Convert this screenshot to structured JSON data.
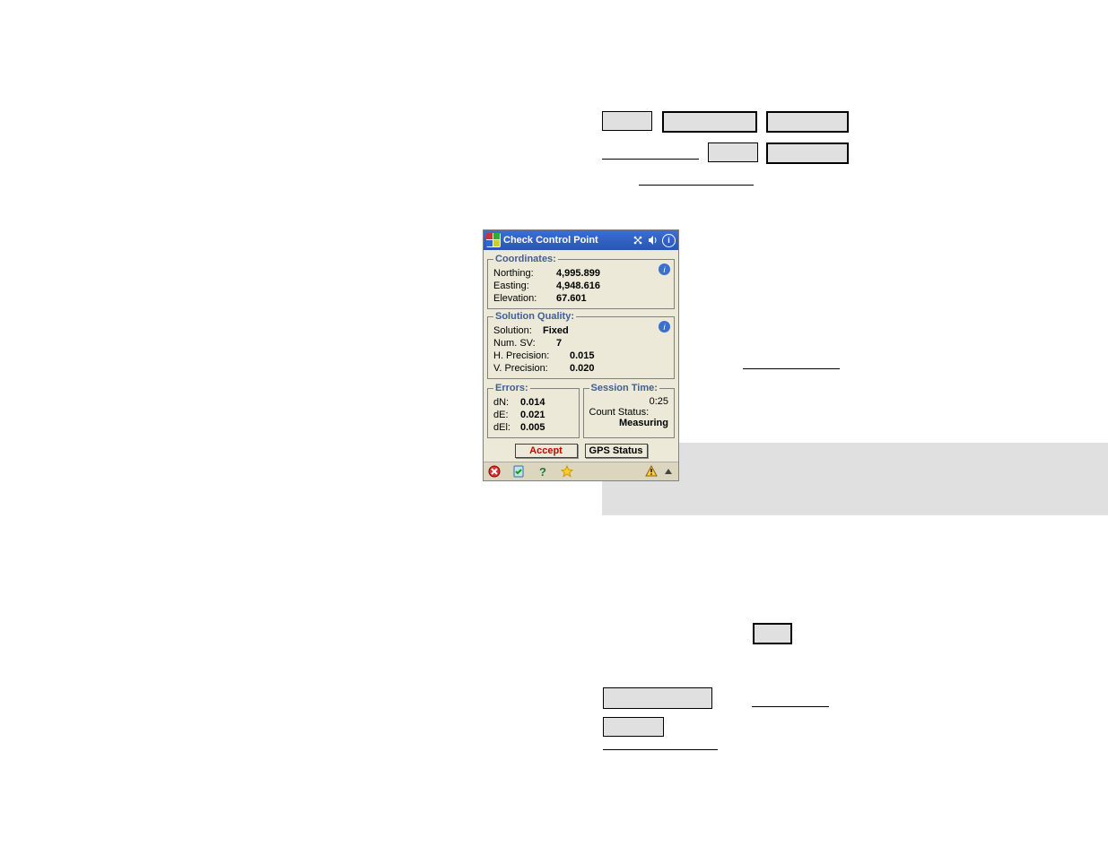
{
  "titlebar": {
    "title": "Check Control Point"
  },
  "coordinates": {
    "legend": "Coordinates:",
    "northing_label": "Northing:",
    "northing": "4,995.899",
    "easting_label": "Easting:",
    "easting": "4,948.616",
    "elevation_label": "Elevation:",
    "elevation": "67.601"
  },
  "solution": {
    "legend": "Solution Quality:",
    "solution_label": "Solution:",
    "solution": "Fixed",
    "numsv_label": "Num. SV:",
    "numsv": "7",
    "hprec_label": "H. Precision:",
    "hprec": "0.015",
    "vprec_label": "V. Precision:",
    "vprec": "0.020"
  },
  "errors": {
    "legend": "Errors:",
    "dn_label": "dN:",
    "dn": "0.014",
    "de_label": "dE:",
    "de": "0.021",
    "del_label": "dEl:",
    "del": "0.005"
  },
  "session": {
    "legend": "Session Time:",
    "time": "0:25",
    "count_label": "Count Status:",
    "status": "Measuring"
  },
  "buttons": {
    "accept": "Accept",
    "gps_status": "GPS Status"
  },
  "icons": {
    "info": "i"
  }
}
